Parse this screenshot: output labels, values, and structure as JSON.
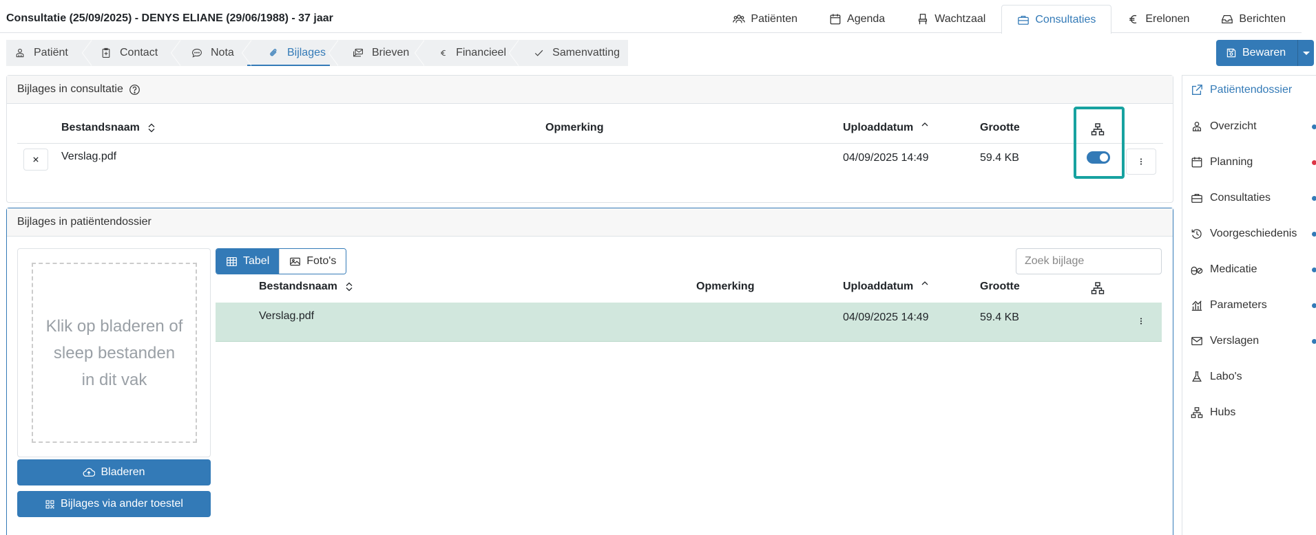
{
  "header": {
    "title": "Consultatie (25/09/2025) - DENYS ELIANE (29/06/1988) - 37 jaar",
    "nav": [
      {
        "label": "Patiënten",
        "icon": "users-icon"
      },
      {
        "label": "Agenda",
        "icon": "calendar-icon"
      },
      {
        "label": "Wachtzaal",
        "icon": "chair-icon"
      },
      {
        "label": "Consultaties",
        "icon": "briefcase-icon",
        "active": true
      },
      {
        "label": "Erelonen",
        "icon": "euro-icon"
      },
      {
        "label": "Berichten",
        "icon": "inbox-icon"
      }
    ]
  },
  "steps": [
    {
      "label": "Patiënt",
      "icon": "person-icon"
    },
    {
      "label": "Contact",
      "icon": "clipboard-plus-icon"
    },
    {
      "label": "Nota",
      "icon": "chat-icon"
    },
    {
      "label": "Bijlages",
      "icon": "paperclip-icon",
      "active": true
    },
    {
      "label": "Brieven",
      "icon": "envelopes-icon"
    },
    {
      "label": "Financieel",
      "icon": "euro-icon"
    },
    {
      "label": "Samenvatting",
      "icon": "check-icon"
    }
  ],
  "save": {
    "label": "Bewaren"
  },
  "consult_panel": {
    "title": "Bijlages in consultatie",
    "columns": {
      "name": "Bestandsnaam",
      "remark": "Opmerking",
      "date": "Uploaddatum",
      "size": "Grootte"
    },
    "rows": [
      {
        "name": "Verslag.pdf",
        "remark": "",
        "date": "04/09/2025 14:49",
        "size": "59.4 KB",
        "hub_shared": true
      }
    ]
  },
  "dossier_panel": {
    "title": "Bijlages in patiëntendossier",
    "dropzone_text": "Klik op bladeren of sleep bestanden in dit vak",
    "browse_label": "Bladeren",
    "other_device_label": "Bijlages via ander toestel",
    "view_tabs": [
      {
        "label": "Tabel",
        "icon": "table-icon",
        "active": true
      },
      {
        "label": "Foto's",
        "icon": "image-icon"
      }
    ],
    "search_placeholder": "Zoek bijlage",
    "columns": {
      "name": "Bestandsnaam",
      "remark": "Opmerking",
      "date": "Uploaddatum",
      "size": "Grootte"
    },
    "rows": [
      {
        "name": "Verslag.pdf",
        "remark": "",
        "date": "04/09/2025 14:49",
        "size": "59.4 KB",
        "selected": true
      }
    ]
  },
  "sidebar": {
    "items": [
      {
        "label": "Patiëntendossier",
        "icon": "external-link-icon",
        "dot": null
      },
      {
        "label": "Overzicht",
        "icon": "person-icon",
        "dot": "#337ab7"
      },
      {
        "label": "Planning",
        "icon": "calendar-icon",
        "dot": "#dc3545"
      },
      {
        "label": "Consultaties",
        "icon": "briefcase-icon",
        "dot": "#337ab7"
      },
      {
        "label": "Voorgeschiedenis",
        "icon": "history-icon",
        "dot": "#337ab7"
      },
      {
        "label": "Medicatie",
        "icon": "pills-icon",
        "dot": "#337ab7"
      },
      {
        "label": "Parameters",
        "icon": "chart-icon",
        "dot": "#337ab7"
      },
      {
        "label": "Verslagen",
        "icon": "envelope-icon",
        "dot": "#337ab7"
      },
      {
        "label": "Labo's",
        "icon": "flask-icon",
        "dot": null
      },
      {
        "label": "Hubs",
        "icon": "network-icon",
        "dot": null
      }
    ]
  },
  "colors": {
    "primary": "#337ab7",
    "highlight": "#17a2a0",
    "selected_row": "#d1e7dd",
    "alert": "#dc3545"
  }
}
